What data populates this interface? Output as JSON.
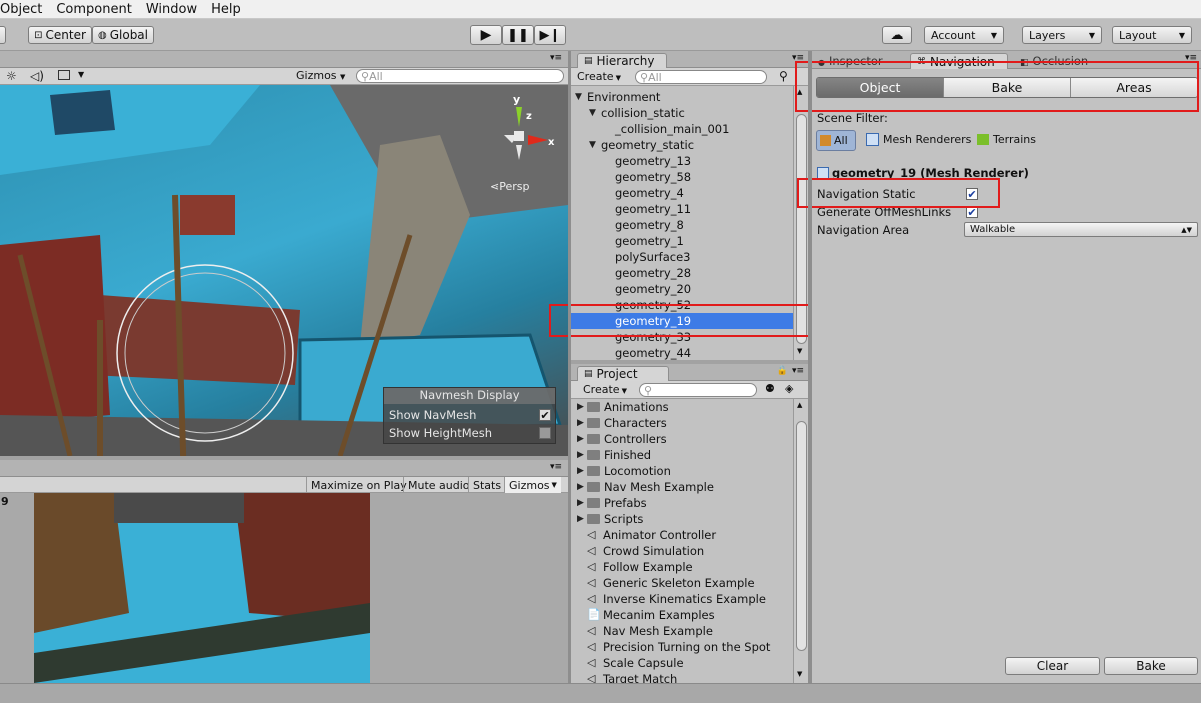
{
  "menu": [
    "Object",
    "Component",
    "Window",
    "Help"
  ],
  "toolbar": {
    "pivot": "Center",
    "space": "Global",
    "account": "Account",
    "layers": "Layers",
    "layout": "Layout"
  },
  "scene": {
    "gizmos": "Gizmos",
    "search_placeholder": "All",
    "persp": "Persp",
    "axis_labels": {
      "y": "y",
      "z": "z",
      "x": "x"
    },
    "navmesh_display": {
      "title": "Navmesh Display",
      "show_navmesh": "Show NavMesh",
      "show_heightmesh": "Show HeightMesh",
      "show_navmesh_checked": true,
      "show_heightmesh_checked": false
    }
  },
  "game": {
    "maximize": "Maximize on Play",
    "mute": "Mute audio",
    "stats": "Stats",
    "gizmos": "Gizmos",
    "corner_label": "9"
  },
  "hierarchy": {
    "tab": "Hierarchy",
    "create": "Create",
    "search_placeholder": "All",
    "items": [
      {
        "label": "Environment",
        "indent": 0,
        "arrow": "down"
      },
      {
        "label": "collision_static",
        "indent": 1,
        "arrow": "down"
      },
      {
        "label": "_collision_main_001",
        "indent": 2,
        "arrow": ""
      },
      {
        "label": "geometry_static",
        "indent": 1,
        "arrow": "down"
      },
      {
        "label": "geometry_13",
        "indent": 2,
        "arrow": ""
      },
      {
        "label": "geometry_58",
        "indent": 2,
        "arrow": ""
      },
      {
        "label": "geometry_4",
        "indent": 2,
        "arrow": ""
      },
      {
        "label": "geometry_11",
        "indent": 2,
        "arrow": ""
      },
      {
        "label": "geometry_8",
        "indent": 2,
        "arrow": ""
      },
      {
        "label": "geometry_1",
        "indent": 2,
        "arrow": ""
      },
      {
        "label": "polySurface3",
        "indent": 2,
        "arrow": ""
      },
      {
        "label": "geometry_28",
        "indent": 2,
        "arrow": ""
      },
      {
        "label": "geometry_20",
        "indent": 2,
        "arrow": ""
      },
      {
        "label": "geometry_52",
        "indent": 2,
        "arrow": ""
      },
      {
        "label": "geometry_19",
        "indent": 2,
        "arrow": "",
        "selected": true
      },
      {
        "label": "geometry_33",
        "indent": 2,
        "arrow": ""
      },
      {
        "label": "geometry_44",
        "indent": 2,
        "arrow": ""
      }
    ]
  },
  "project": {
    "tab": "Project",
    "create": "Create",
    "items": [
      {
        "label": "Animations",
        "type": "folder"
      },
      {
        "label": "Characters",
        "type": "folder"
      },
      {
        "label": "Controllers",
        "type": "folder"
      },
      {
        "label": "Finished",
        "type": "folder"
      },
      {
        "label": "Locomotion",
        "type": "folder"
      },
      {
        "label": "Nav Mesh Example",
        "type": "folder"
      },
      {
        "label": "Prefabs",
        "type": "folder"
      },
      {
        "label": "Scripts",
        "type": "folder"
      },
      {
        "label": "Animator Controller",
        "type": "unity"
      },
      {
        "label": "Crowd Simulation",
        "type": "unity"
      },
      {
        "label": "Follow Example",
        "type": "unity"
      },
      {
        "label": "Generic Skeleton Example",
        "type": "unity"
      },
      {
        "label": "Inverse Kinematics Example",
        "type": "unity"
      },
      {
        "label": "Mecanim Examples",
        "type": "pdf"
      },
      {
        "label": "Nav Mesh Example",
        "type": "unity"
      },
      {
        "label": "Precision Turning on the Spot",
        "type": "unity"
      },
      {
        "label": "Scale Capsule",
        "type": "unity"
      },
      {
        "label": "Target Match",
        "type": "unity"
      }
    ]
  },
  "inspector": {
    "tabs": [
      "Inspector",
      "Navigation",
      "Occlusion"
    ],
    "nav_tabs": [
      "Object",
      "Bake",
      "Areas"
    ],
    "active_nav_tab": "Object",
    "scene_filter_label": "Scene Filter:",
    "filters": [
      "All",
      "Mesh Renderers",
      "Terrains"
    ],
    "object_title": "geometry_19 (Mesh Renderer)",
    "fields": [
      {
        "label": "Navigation Static",
        "checked": true
      },
      {
        "label": "Generate OffMeshLinks",
        "checked": true
      }
    ],
    "navigation_area_label": "Navigation Area",
    "navigation_area_value": "Walkable",
    "clear": "Clear",
    "bake": "Bake"
  },
  "colors": {
    "selection": "#3d7be6",
    "highlight_box": "#e11b1b",
    "navmesh": "#3aaad0"
  }
}
